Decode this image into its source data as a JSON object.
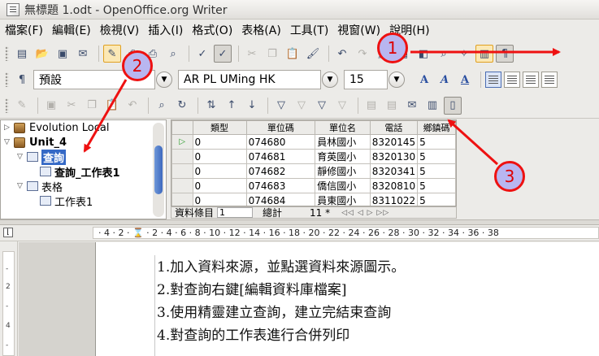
{
  "window": {
    "title": "無標題 1.odt - OpenOffice.org Writer"
  },
  "menu": [
    "檔案(F)",
    "編輯(E)",
    "檢視(V)",
    "插入(I)",
    "格式(O)",
    "表格(A)",
    "工具(T)",
    "視窗(W)",
    "說明(H)"
  ],
  "formatting": {
    "style": "預設",
    "font": "AR PL UMing HK",
    "size": "15",
    "bold_letter": "A"
  },
  "explorer": {
    "items": [
      {
        "label": "Evolution Local",
        "level": 0,
        "expander": "▷"
      },
      {
        "label": "Unit_4",
        "level": 0,
        "expander": "▽"
      },
      {
        "label": "查詢",
        "level": 1,
        "expander": "▽"
      },
      {
        "label": "查詢_工作表1",
        "level": 2,
        "expander": ""
      },
      {
        "label": "表格",
        "level": 1,
        "expander": "▽"
      },
      {
        "label": "工作表1",
        "level": 2,
        "expander": ""
      }
    ]
  },
  "grid": {
    "columns": [
      "類型",
      "單位碼",
      "單位名",
      "電話",
      "鄉鎮碼"
    ],
    "rows": [
      [
        "0",
        "074680",
        "員林國小",
        "8320145",
        "5"
      ],
      [
        "0",
        "074681",
        "育英國小",
        "8320130",
        "5"
      ],
      [
        "0",
        "074682",
        "靜修國小",
        "8320341",
        "5"
      ],
      [
        "0",
        "074683",
        "僑信國小",
        "8320810",
        "5"
      ],
      [
        "0",
        "074684",
        "員東國小",
        "8311022",
        "5"
      ]
    ],
    "record_label": "資料條目",
    "record_value": "1",
    "total_label": "總計",
    "total_value": "11 *"
  },
  "ruler": {
    "text": "· 4 · 2 · ⌛ · 2 · 4 · 6 · 8 · 10 · 12 · 14 · 16 · 18 · 20 · 22 · 24 · 26 · 28 · 30 · 32 · 34 · 36 · 38"
  },
  "vruler": [
    "-",
    "2",
    "-",
    "4",
    "-"
  ],
  "document": {
    "lines": [
      "1.加入資料來源，並點選資料來源圖示。",
      "2.對查詢右鍵[編輯資料庫檔案]",
      "3.使用精靈建立查詢，建立完結束查詢",
      "4.對查詢的工作表進行合併列印"
    ]
  },
  "callouts": [
    "1",
    "2",
    "3"
  ],
  "colors": {
    "callout_border": "#e11111",
    "callout_fill": "#b8b6f0",
    "selection": "#3569c6"
  }
}
